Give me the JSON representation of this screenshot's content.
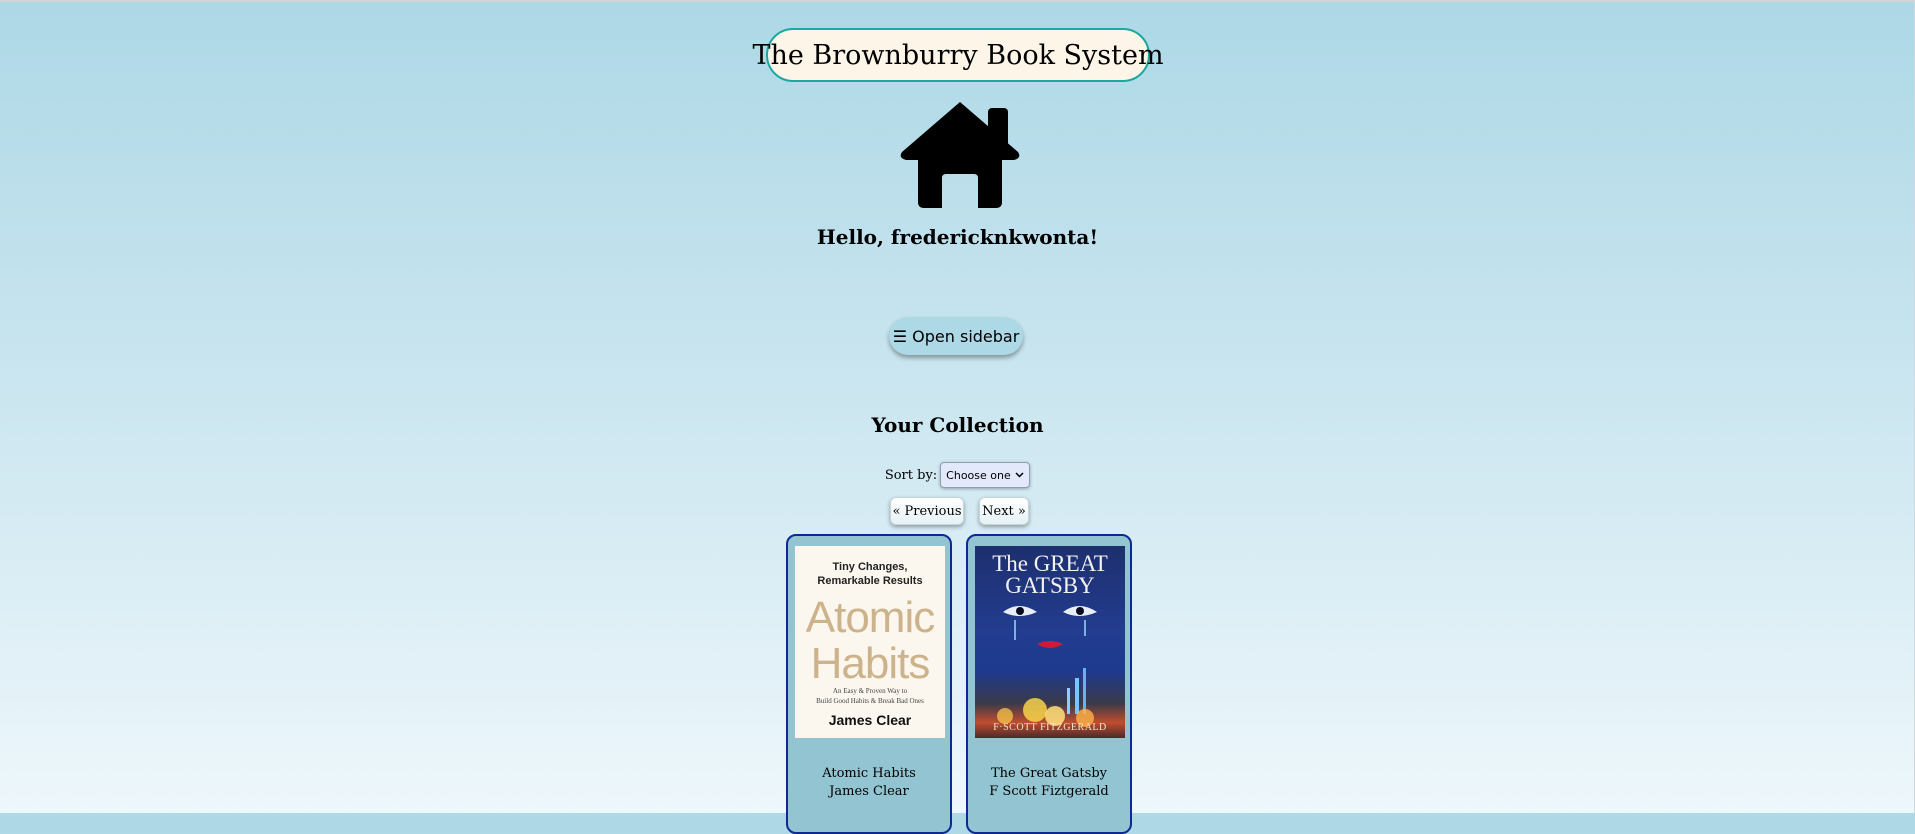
{
  "header": {
    "app_title": "The Brownburry Book System",
    "home_icon": "home-icon",
    "greeting": "Hello, fredericknkwonta!"
  },
  "sidebar_toggle": {
    "icon": "hamburger-icon",
    "glyph": "☰",
    "label": "Open sidebar"
  },
  "collection": {
    "title": "Your Collection",
    "sort_label": "Sort by:",
    "sort_value": "Choose one",
    "pagination": {
      "previous_label": "« Previous",
      "next_label": "Next »"
    },
    "books": [
      {
        "title": "Atomic Habits",
        "author": "James Clear",
        "cover_lines": {
          "tagline_1": "Tiny Changes,",
          "tagline_2": "Remarkable Results",
          "title_1": "Atomic",
          "title_2": "Habits",
          "subtitle_1": "An Easy & Proven Way to",
          "subtitle_2": "Build Good Habits & Break Bad Ones",
          "author": "James Clear"
        }
      },
      {
        "title": "The Great Gatsby",
        "author": "F Scott Fiztgerald",
        "cover_lines": {
          "title_1": "The GREAT",
          "title_2": "GATSBY",
          "author": "F·SCOTT FITZGERALD"
        }
      }
    ]
  },
  "colors": {
    "background_top": "#add8e6",
    "title_border": "#1ba89f",
    "title_fill": "#fdf5e8",
    "card_fill": "#92c4d2",
    "card_border": "#0f2a8f"
  }
}
